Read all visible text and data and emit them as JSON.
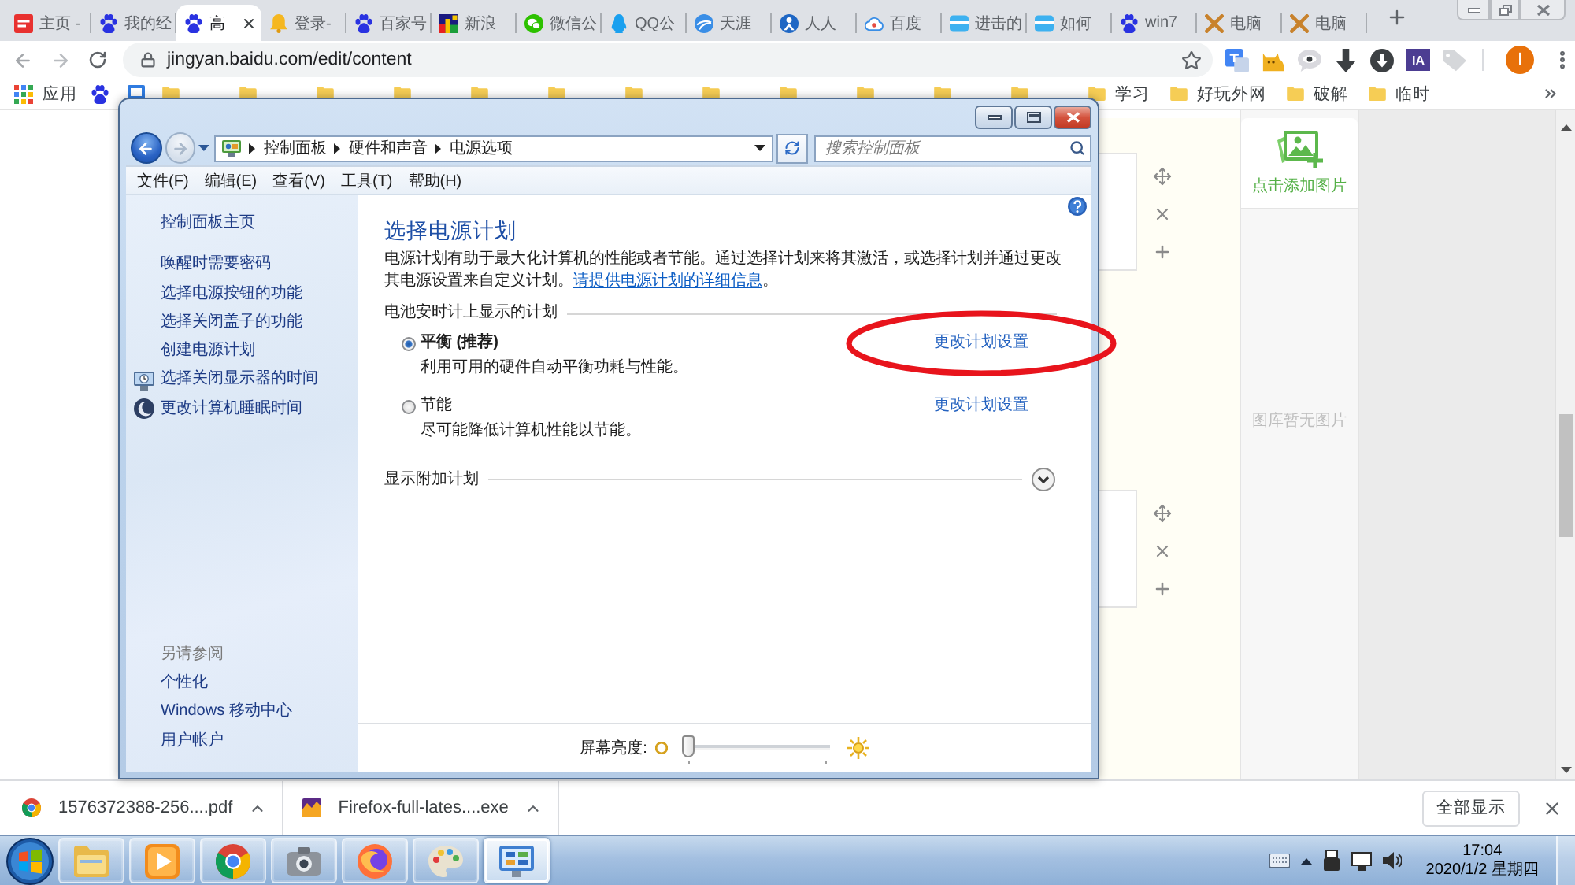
{
  "browser_tabs": [
    {
      "kind": "news",
      "label": "主页 -",
      "selected": false
    },
    {
      "kind": "paw",
      "label": "我的经",
      "selected": false
    },
    {
      "kind": "paw",
      "label": "高",
      "selected": true
    },
    {
      "kind": "bell",
      "label": "登录-",
      "selected": false
    },
    {
      "kind": "paw",
      "label": "百家号",
      "selected": false
    },
    {
      "kind": "mosaic",
      "label": "新浪",
      "selected": false
    },
    {
      "kind": "chat",
      "label": "微信公",
      "selected": false
    },
    {
      "kind": "penguin",
      "label": "QQ公",
      "selected": false
    },
    {
      "kind": "globe",
      "label": "天涯",
      "selected": false
    },
    {
      "kind": "people",
      "label": "人人",
      "selected": false
    },
    {
      "kind": "cloud",
      "label": "百度",
      "selected": false
    },
    {
      "kind": "box",
      "label": "进击的",
      "selected": false
    },
    {
      "kind": "box",
      "label": "如何",
      "selected": false
    },
    {
      "kind": "paw",
      "label": "win7",
      "selected": false
    },
    {
      "kind": "tools",
      "label": "电脑",
      "selected": false
    },
    {
      "kind": "tools",
      "label": "电脑",
      "selected": false
    }
  ],
  "toolbar": {
    "url": "jingyan.baidu.com/edit/content",
    "extensions": [
      {
        "kind": "tile"
      },
      {
        "kind": "cat"
      },
      {
        "kind": "eye"
      },
      {
        "kind": "arrow"
      },
      {
        "kind": "disc"
      },
      {
        "kind": "text",
        "label": "IA"
      },
      {
        "kind": "tag"
      }
    ],
    "profile_initial": "I"
  },
  "bookmarks": [
    {
      "kind": "apps",
      "label": "应用"
    },
    {
      "kind": "paw"
    },
    {
      "kind": "page"
    },
    {
      "kind": "folder"
    },
    {
      "kind": "folder"
    },
    {
      "kind": "folder"
    },
    {
      "kind": "folder"
    },
    {
      "kind": "folder"
    },
    {
      "kind": "folder"
    },
    {
      "kind": "folder"
    },
    {
      "kind": "folder"
    },
    {
      "kind": "folder"
    },
    {
      "kind": "folder"
    },
    {
      "kind": "folder"
    },
    {
      "kind": "folder"
    },
    {
      "kind": "folder",
      "label": "学习"
    },
    {
      "kind": "folder",
      "label": "好玩外网"
    },
    {
      "kind": "folder",
      "label": "破解"
    },
    {
      "kind": "folder",
      "label": "临时"
    }
  ],
  "control_panel_window": {
    "breadcrumb": [
      "控制面板",
      "硬件和声音",
      "电源选项"
    ],
    "search": {
      "placeholder": "搜索控制面板"
    },
    "menu": [
      "文件(F)",
      "编辑(E)",
      "查看(V)",
      "工具(T)",
      "帮助(H)"
    ],
    "sidebar": {
      "home": "控制面板主页",
      "tasks": [
        {
          "kind": "plain",
          "label": "唤醒时需要密码"
        },
        {
          "kind": "plain",
          "label": "选择电源按钮的功能"
        },
        {
          "kind": "plain",
          "label": "选择关闭盖子的功能"
        },
        {
          "kind": "plain",
          "label": "创建电源计划"
        },
        {
          "kind": "display",
          "label": "选择关闭显示器的时间"
        },
        {
          "kind": "sleep",
          "label": "更改计算机睡眠时间"
        }
      ],
      "see_also_heading": "另请参阅",
      "see_also": [
        "个性化",
        "Windows 移动中心",
        "用户帐户"
      ]
    },
    "title": "选择电源计划",
    "intro": {
      "text": "电源计划有助于最大化计算机的性能或者节能。通过选择计划来将其激活，或选择计划并通过更改其电源设置来自定义计划。",
      "link": "请提供电源计划的详细信息",
      "end": "。"
    },
    "plans_heading": "电池安时计上显示的计划",
    "plans": [
      {
        "name": "平衡 (推荐)",
        "description": "利用可用的硬件自动平衡功耗与性能。",
        "link": "更改计划设置",
        "selected": true,
        "annotated": true
      },
      {
        "name": "节能",
        "description": "尽可能降低计算机性能以节能。",
        "link": "更改计划设置",
        "selected": false,
        "annotated": false
      }
    ],
    "additional_plans": {
      "label": "显示附加计划",
      "expanded": false
    },
    "brightness": {
      "label": "屏幕亮度:",
      "level": 0
    }
  },
  "image_panel": {
    "add_label": "点击添加图片",
    "empty_text": "图库暂无图片"
  },
  "downloads": {
    "items": [
      {
        "kind": "pdf",
        "name": "1576372388-256....pdf"
      },
      {
        "kind": "installer",
        "name": "Firefox-full-lates....exe"
      }
    ],
    "show_all": "全部显示"
  },
  "taskbar": {
    "apps": [
      {
        "kind": "folder",
        "selected": false
      },
      {
        "kind": "media",
        "selected": false
      },
      {
        "kind": "ring",
        "selected": false
      },
      {
        "kind": "camera",
        "selected": false
      },
      {
        "kind": "fox",
        "selected": false
      },
      {
        "kind": "paint",
        "selected": false
      },
      {
        "kind": "panel",
        "selected": true
      }
    ],
    "time": "17:04",
    "date": "2020/1/2 星期四"
  }
}
